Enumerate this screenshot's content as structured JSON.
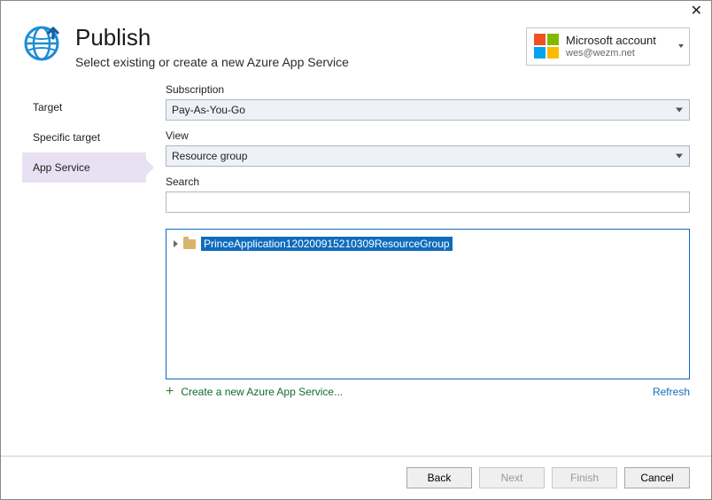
{
  "header": {
    "title": "Publish",
    "subtitle": "Select existing or create a new Azure App Service"
  },
  "account": {
    "label": "Microsoft account",
    "email": "wes@wezm.net"
  },
  "nav": {
    "items": [
      {
        "label": "Target",
        "active": false
      },
      {
        "label": "Specific target",
        "active": false
      },
      {
        "label": "App Service",
        "active": true
      }
    ]
  },
  "form": {
    "subscription_label": "Subscription",
    "subscription_value": "Pay-As-You-Go",
    "view_label": "View",
    "view_value": "Resource group",
    "search_label": "Search",
    "search_value": ""
  },
  "tree": {
    "items": [
      {
        "label": "PrinceApplication120200915210309ResourceGroup",
        "selected": true
      }
    ]
  },
  "links": {
    "create": "Create a new Azure App Service...",
    "refresh": "Refresh"
  },
  "buttons": {
    "back": "Back",
    "next": "Next",
    "finish": "Finish",
    "cancel": "Cancel"
  }
}
